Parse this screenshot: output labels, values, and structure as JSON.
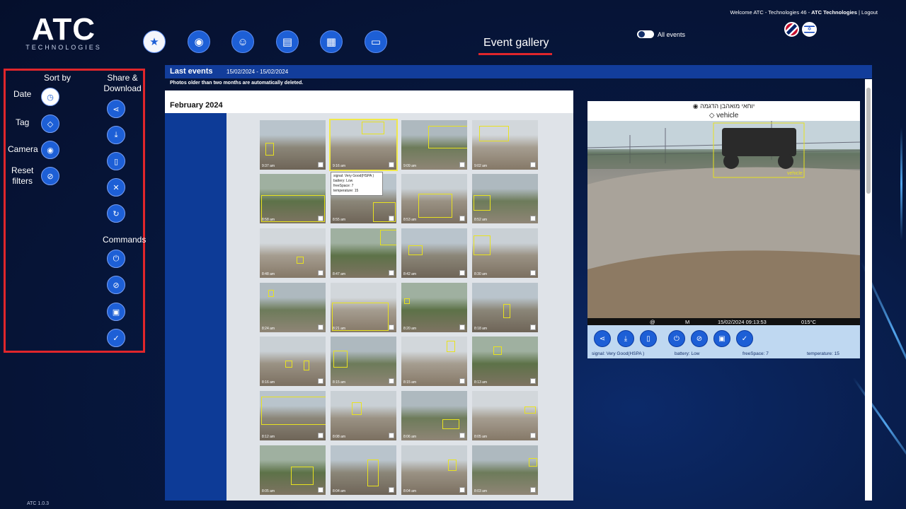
{
  "brand": {
    "name": "ATC",
    "sub": "TECHNOLOGIES",
    "version": "ATC 1.0.3"
  },
  "nav": [
    {
      "name": "calendar",
      "icon": "calendar-star-icon",
      "glyph": "★",
      "active": true
    },
    {
      "name": "camera",
      "icon": "camera-icon",
      "glyph": "◉"
    },
    {
      "name": "user-settings",
      "icon": "user-gear-icon",
      "glyph": "☺"
    },
    {
      "name": "id-card",
      "icon": "id-card-icon",
      "glyph": "▤"
    },
    {
      "name": "grid",
      "icon": "qr-grid-icon",
      "glyph": "▦"
    },
    {
      "name": "card",
      "icon": "credit-card-icon",
      "glyph": "▭"
    }
  ],
  "page_title": "Event gallery",
  "toggle_label": "All events",
  "welcome": {
    "text": "Welcome ATC - Technologies 46  -  ",
    "company": "ATC Technologies",
    "sep": "|",
    "logout": "Logout"
  },
  "langs": [
    "EN",
    "IL"
  ],
  "sidebar": {
    "sort_by": "Sort by",
    "date": "Date",
    "tag": "Tag",
    "camera": "Camera",
    "reset": "Reset",
    "filters": "filters",
    "share_download_1": "Share &",
    "share_download_2": "Download",
    "commands": "Commands"
  },
  "header": {
    "title": "Last events",
    "range": "15/02/2024 - 15/02/2024"
  },
  "note": "Photos older than two months are automatically deleted.",
  "gallery": {
    "month": "February 2024",
    "times": [
      "9:37 am",
      "9:16 am",
      "9:09 am",
      "9:02 am",
      "8:58 am",
      "8:55 am",
      "8:53 am",
      "8:52 am",
      "8:48 am",
      "8:47 am",
      "8:42 am",
      "8:30 am",
      "8:24 am",
      "8:21 am",
      "8:20 am",
      "8:18 am",
      "8:16 am",
      "8:15 am",
      "8:15 am",
      "8:13 am",
      "8:12 am",
      "8:08 am",
      "8:06 am",
      "8:05 am",
      "8:05 am",
      "8:04 am",
      "8:04 am",
      "8:03 am"
    ]
  },
  "tooltip": {
    "signal": "signal: Very Good(HSPA )",
    "battery": "battery: Low",
    "freespace": "freeSpace: 7",
    "temperature": "temperature: 15"
  },
  "viewer": {
    "camera_name": "יוחאי מואהבן הדגמה",
    "tag": "vehicle",
    "box_label": "vehicle",
    "stamp_at": "@",
    "stamp_m": "M",
    "stamp_dt": "15/02/2024 09:13:53",
    "stamp_temp": "015°C",
    "status": {
      "signal": "signal: Very Good(HSPA )",
      "battery": "battery: Low",
      "freespace": "freeSpace: 7",
      "temperature": "temperature: 15"
    }
  }
}
